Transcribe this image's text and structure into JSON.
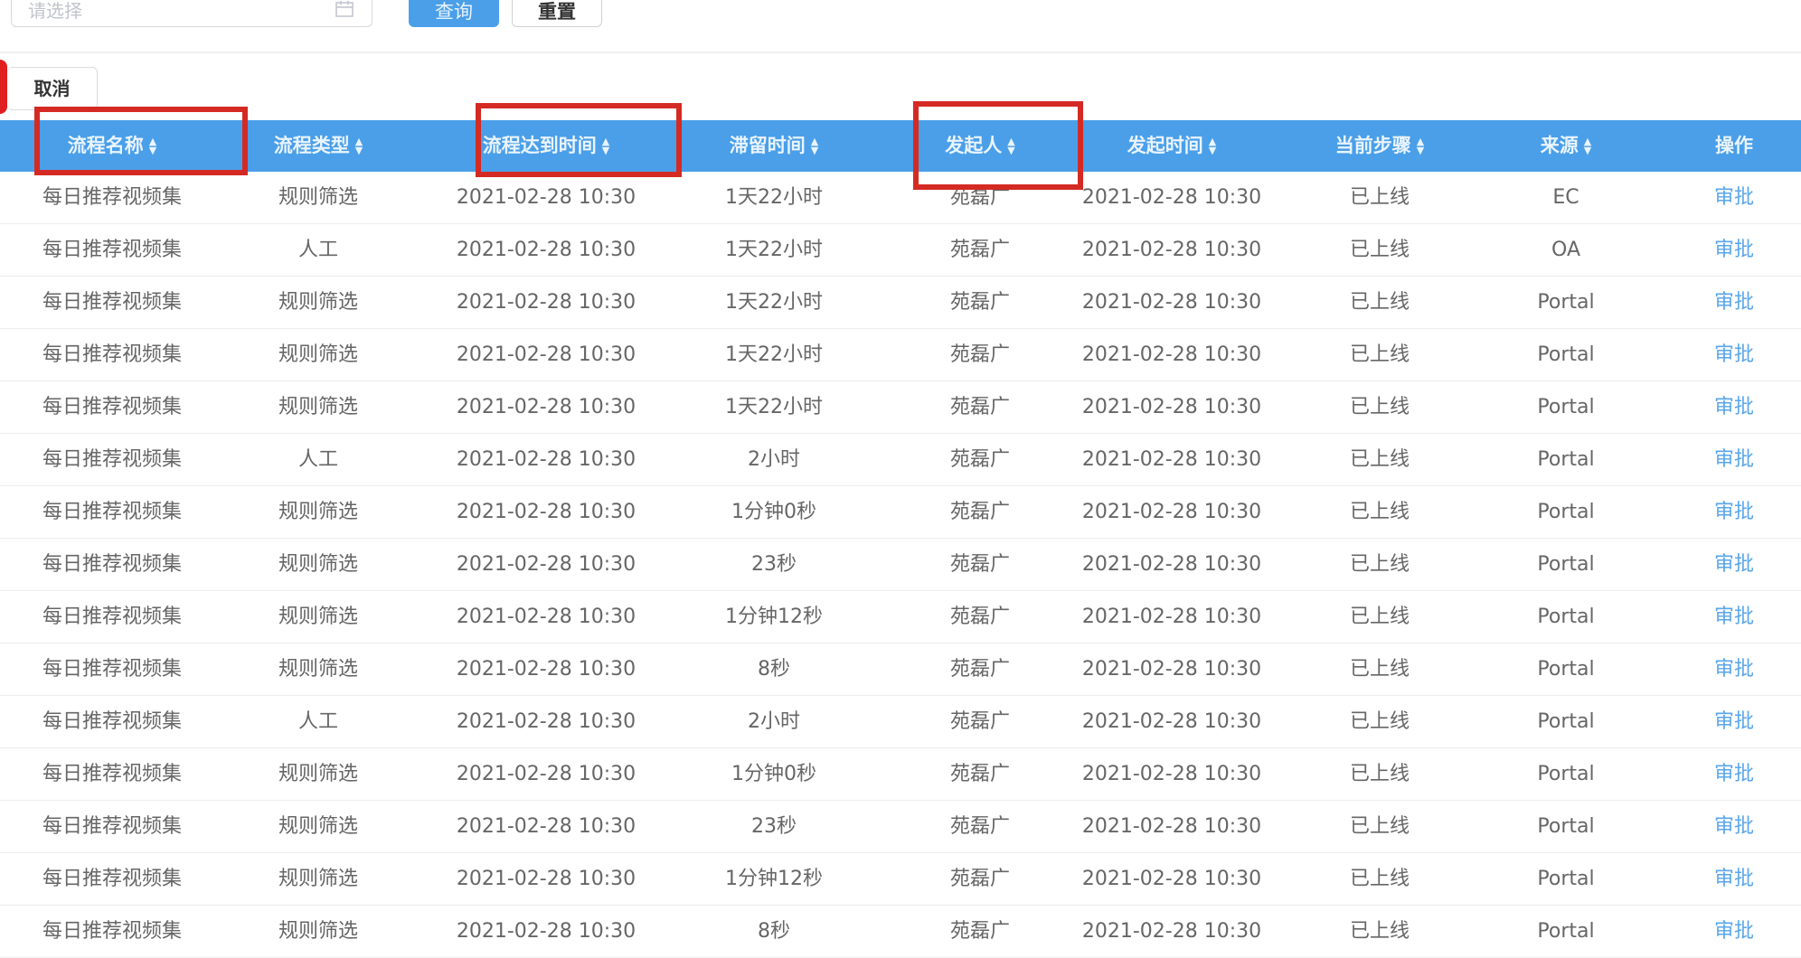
{
  "filters": {
    "date_placeholder": "请选择",
    "query_label": "查询",
    "reset_label": "重置"
  },
  "toolbar": {
    "cancel_label": "取消"
  },
  "table": {
    "columns": [
      {
        "label": "流程名称"
      },
      {
        "label": "流程类型"
      },
      {
        "label": "流程达到时间"
      },
      {
        "label": "滞留时间"
      },
      {
        "label": "发起人"
      },
      {
        "label": "发起时间"
      },
      {
        "label": "当前步骤"
      },
      {
        "label": "来源"
      },
      {
        "label": "操作"
      }
    ],
    "rows": [
      [
        "每日推荐视频集",
        "规则筛选",
        "2021-02-28 10:30",
        "1天22小时",
        "苑磊广",
        "2021-02-28 10:30",
        "已上线",
        "EC",
        "审批"
      ],
      [
        "每日推荐视频集",
        "人工",
        "2021-02-28 10:30",
        "1天22小时",
        "苑磊广",
        "2021-02-28 10:30",
        "已上线",
        "OA",
        "审批"
      ],
      [
        "每日推荐视频集",
        "规则筛选",
        "2021-02-28 10:30",
        "1天22小时",
        "苑磊广",
        "2021-02-28 10:30",
        "已上线",
        "Portal",
        "审批"
      ],
      [
        "每日推荐视频集",
        "规则筛选",
        "2021-02-28 10:30",
        "1天22小时",
        "苑磊广",
        "2021-02-28 10:30",
        "已上线",
        "Portal",
        "审批"
      ],
      [
        "每日推荐视频集",
        "规则筛选",
        "2021-02-28 10:30",
        "1天22小时",
        "苑磊广",
        "2021-02-28 10:30",
        "已上线",
        "Portal",
        "审批"
      ],
      [
        "每日推荐视频集",
        "人工",
        "2021-02-28 10:30",
        "2小时",
        "苑磊广",
        "2021-02-28 10:30",
        "已上线",
        "Portal",
        "审批"
      ],
      [
        "每日推荐视频集",
        "规则筛选",
        "2021-02-28 10:30",
        "1分钟0秒",
        "苑磊广",
        "2021-02-28 10:30",
        "已上线",
        "Portal",
        "审批"
      ],
      [
        "每日推荐视频集",
        "规则筛选",
        "2021-02-28 10:30",
        "23秒",
        "苑磊广",
        "2021-02-28 10:30",
        "已上线",
        "Portal",
        "审批"
      ],
      [
        "每日推荐视频集",
        "规则筛选",
        "2021-02-28 10:30",
        "1分钟12秒",
        "苑磊广",
        "2021-02-28 10:30",
        "已上线",
        "Portal",
        "审批"
      ],
      [
        "每日推荐视频集",
        "规则筛选",
        "2021-02-28 10:30",
        "8秒",
        "苑磊广",
        "2021-02-28 10:30",
        "已上线",
        "Portal",
        "审批"
      ],
      [
        "每日推荐视频集",
        "人工",
        "2021-02-28 10:30",
        "2小时",
        "苑磊广",
        "2021-02-28 10:30",
        "已上线",
        "Portal",
        "审批"
      ],
      [
        "每日推荐视频集",
        "规则筛选",
        "2021-02-28 10:30",
        "1分钟0秒",
        "苑磊广",
        "2021-02-28 10:30",
        "已上线",
        "Portal",
        "审批"
      ],
      [
        "每日推荐视频集",
        "规则筛选",
        "2021-02-28 10:30",
        "23秒",
        "苑磊广",
        "2021-02-28 10:30",
        "已上线",
        "Portal",
        "审批"
      ],
      [
        "每日推荐视频集",
        "规则筛选",
        "2021-02-28 10:30",
        "1分钟12秒",
        "苑磊广",
        "2021-02-28 10:30",
        "已上线",
        "Portal",
        "审批"
      ],
      [
        "每日推荐视频集",
        "规则筛选",
        "2021-02-28 10:30",
        "8秒",
        "苑磊广",
        "2021-02-28 10:30",
        "已上线",
        "Portal",
        "审批"
      ]
    ]
  },
  "colors": {
    "header_bg": "#4a9fe8",
    "link": "#5aa6ea",
    "highlight": "#d42a23"
  }
}
